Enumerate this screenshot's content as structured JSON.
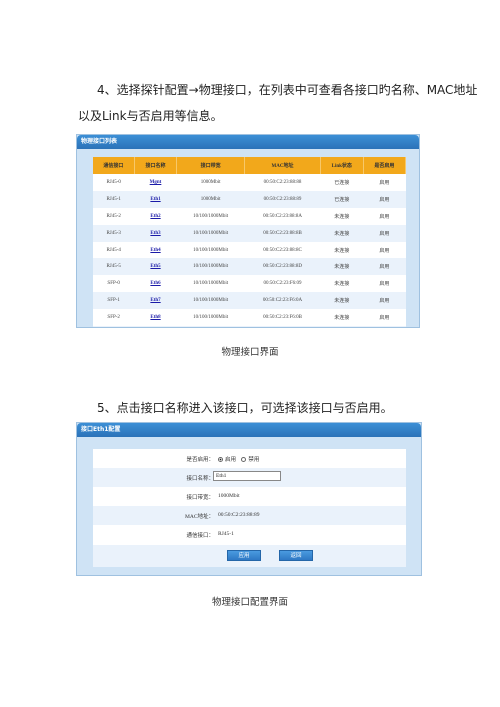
{
  "text": {
    "step4_line1": "4、选择探针配置→物理接口，在列表中可查看各接口旳名称、MAC地址",
    "step4_line2": "以及Link与否启用等信息。",
    "caption1": "物理接口界面",
    "step5": "5、点击接口名称进入该接口，可选择该接口与否启用。",
    "caption2": "物理接口配置界面"
  },
  "panel1": {
    "title": "物理接口列表",
    "headers": [
      "通信接口",
      "接口名称",
      "接口带宽",
      "MAC地址",
      "Link状态",
      "是否启用"
    ],
    "rows": [
      [
        "RJ45-0",
        "Mgnt",
        "1000Mbit",
        "00:50:C2:23:88:88",
        "已连接",
        "启用"
      ],
      [
        "RJ45-1",
        "Eth1",
        "1000Mbit",
        "00:50:C2:23:88:89",
        "已连接",
        "启用"
      ],
      [
        "RJ45-2",
        "Eth2",
        "10/100/1000Mbit",
        "00:50:C2:23:88:8A",
        "未连接",
        "启用"
      ],
      [
        "RJ45-3",
        "Eth3",
        "10/100/1000Mbit",
        "00:50:C2:23:88:8B",
        "未连接",
        "启用"
      ],
      [
        "RJ45-4",
        "Eth4",
        "10/100/1000Mbit",
        "00:50:C2:23:88:8C",
        "未连接",
        "启用"
      ],
      [
        "RJ45-5",
        "Eth5",
        "10/100/1000Mbit",
        "00:50:C2:23:88:8D",
        "未连接",
        "启用"
      ],
      [
        "SFP-0",
        "Eth6",
        "10/100/1000Mbit",
        "00:50:C2:23:F6:09",
        "未连接",
        "启用"
      ],
      [
        "SFP-1",
        "Eth7",
        "10/100/1000Mbit",
        "00:50:C2:23:F6:0A",
        "未连接",
        "启用"
      ],
      [
        "SFP-2",
        "Eth8",
        "10/100/1000Mbit",
        "00:50:C2:23:F6:0B",
        "未连接",
        "启用"
      ],
      [
        "SFP-3",
        "Eth9",
        "10/100/1000Mbit",
        "00:50:C2:23:F6:0C",
        "未连接",
        "启用"
      ]
    ]
  },
  "panel2": {
    "title": "接口Eth1配置",
    "enable_label": "是否启用：",
    "enable_on": "启用",
    "enable_off": "禁用",
    "name_label": "接口名称：",
    "name_value": "Eth1",
    "bandwidth_label": "接口带宽：",
    "bandwidth_value": "1000Mbit",
    "mac_label": "MAC地址：",
    "mac_value": "00:50:C2:23:88:89",
    "port_label": "通信接口：",
    "port_value": "RJ45-1",
    "apply_button": "应用",
    "back_button": "返回"
  },
  "colors": {
    "title_bar": "#2b72b8",
    "header_row": "#f2a81b",
    "panel_bg": "#cfe3f5",
    "link": "#1a1aa8"
  }
}
